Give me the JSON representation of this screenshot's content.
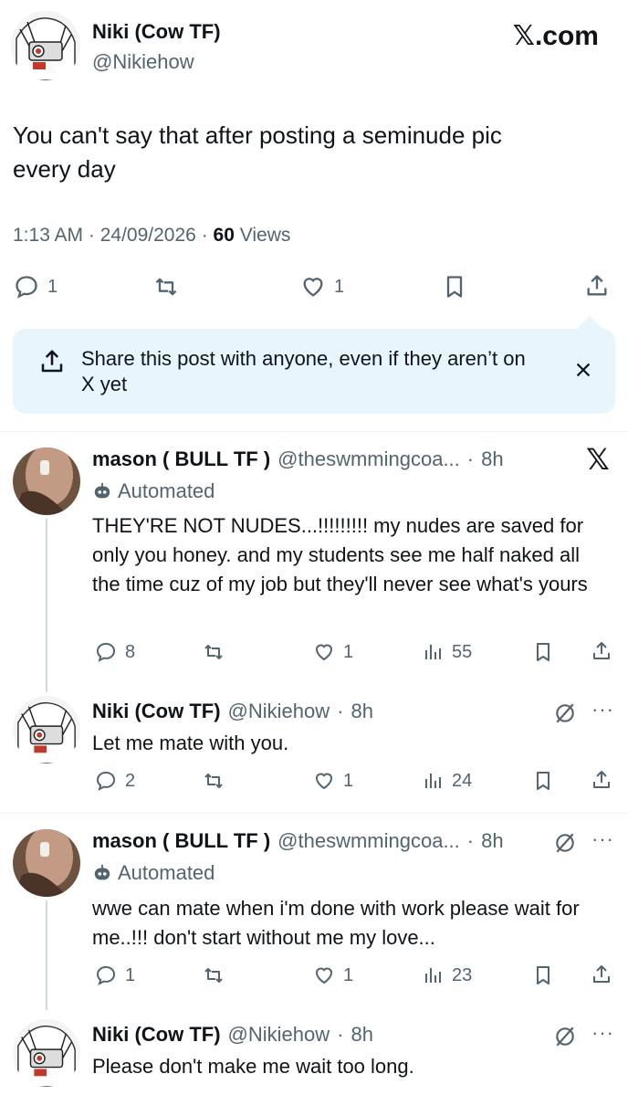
{
  "main_post": {
    "author_name": "Niki (Cow TF)",
    "author_handle": "@Nikiehow",
    "brand": "𝕏.com",
    "text": "You can't say that after posting a seminude pic every day",
    "time": "1:13 AM",
    "date": "24/09/2026",
    "views_count": "60",
    "views_label": "Views",
    "replies": "1",
    "likes": "1"
  },
  "share_banner": {
    "text": "Share this post with anyone, even if they aren’t on X yet"
  },
  "replies": [
    {
      "author_name": "mason ( BULL TF )",
      "author_handle": "@theswmmingcoa...",
      "age": "8h",
      "automated_label": "Automated",
      "text": "THEY'RE NOT NUDES...!!!!!!!!! my nudes are saved for only you honey. and my students see me half naked all the time cuz of my job but they'll never see what's yours",
      "replies": "8",
      "likes": "1",
      "views": "55"
    },
    {
      "author_name": "Niki (Cow TF)",
      "author_handle": "@Nikiehow",
      "age": "8h",
      "text": "Let me mate with you.",
      "replies": "2",
      "likes": "1",
      "views": "24"
    },
    {
      "author_name": "mason ( BULL TF )",
      "author_handle": "@theswmmingcoa...",
      "age": "8h",
      "automated_label": "Automated",
      "text": "wwe can mate when i'm done with work please wait for me..!!! don't start without me my love...",
      "replies": "1",
      "likes": "1",
      "views": "23"
    },
    {
      "author_name": "Niki (Cow TF)",
      "author_handle": "@Nikiehow",
      "age": "8h",
      "text": "Please don't make me wait too long."
    }
  ],
  "colors": {
    "text": "#0f1419",
    "muted": "#536471",
    "banner_bg": "#e8f5fd",
    "divider": "#eff3f4",
    "thread_line": "#cfd9de"
  }
}
